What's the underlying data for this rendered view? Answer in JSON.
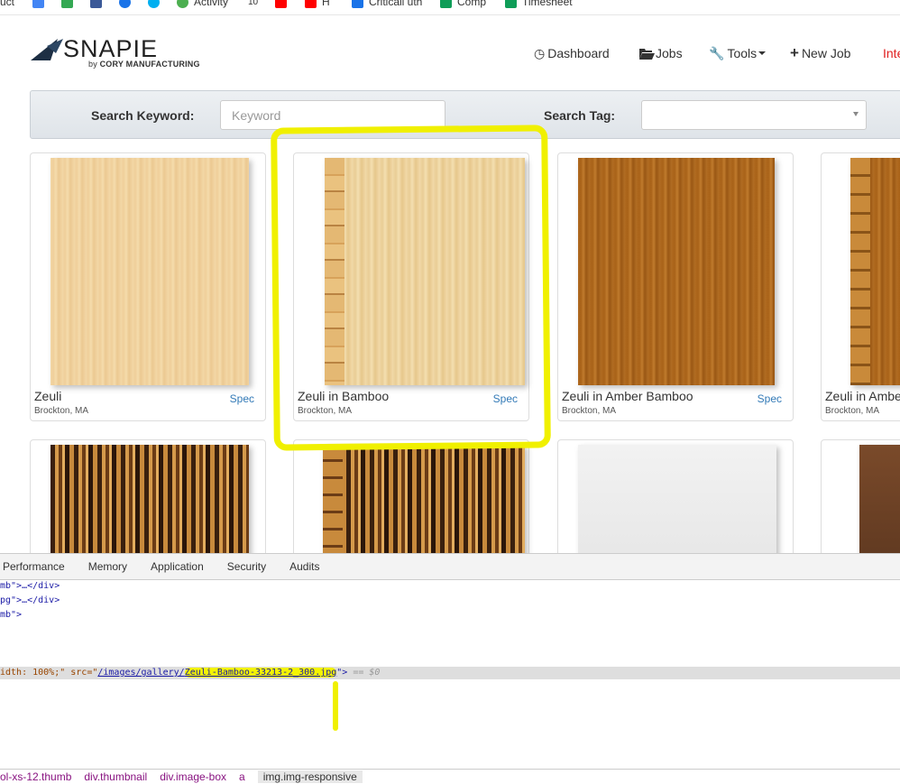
{
  "bookmarks": [
    {
      "label": "uct",
      "color": "#ffffff"
    },
    {
      "label": "",
      "color": "#4285f4"
    },
    {
      "label": "",
      "color": "#34a853"
    },
    {
      "label": "",
      "color": "#3b5998"
    },
    {
      "label": "",
      "color": "#1a73e8"
    },
    {
      "label": "",
      "color": "#00aff0"
    },
    {
      "label": "Activity",
      "color": "#4caf50"
    },
    {
      "label": "10",
      "color": "#ffffff"
    },
    {
      "label": "",
      "color": "#ff0000"
    },
    {
      "label": "H",
      "color": "#ff0000"
    },
    {
      "label": "Criticall uth",
      "color": "#1a73e8"
    },
    {
      "label": "Comp",
      "color": "#0f9d58"
    },
    {
      "label": "Timesheet",
      "color": "#0f9d58"
    }
  ],
  "logo": {
    "word": "SNAPIE",
    "by": "by",
    "company": "CORY MANUFACTURING"
  },
  "nav": {
    "dashboard": "Dashboard",
    "jobs": "Jobs",
    "tools": "Tools",
    "new_job": "New Job",
    "cut": "Inte"
  },
  "search": {
    "keyword_label": "Search Keyword:",
    "keyword_placeholder": "Keyword",
    "tag_label": "Search Tag:",
    "tag_value": ""
  },
  "cards": [
    {
      "title": "Zeuli",
      "spec": "Spec",
      "location": "Brockton, MA"
    },
    {
      "title": "Zeuli in Bamboo",
      "spec": "Spec",
      "location": "Brockton, MA"
    },
    {
      "title": "Zeuli in Amber Bamboo",
      "spec": "Spec",
      "location": "Brockton, MA"
    },
    {
      "title": "Zeuli in Ambe",
      "spec": "",
      "location": "Brockton, MA"
    }
  ],
  "devtools": {
    "tabs": [
      "Performance",
      "Memory",
      "Application",
      "Security",
      "Audits"
    ],
    "lines": [
      "mb\">…</div>",
      "pg\">…</div>",
      "mb\">"
    ],
    "selected": {
      "attr_prefix": "idth: 100%;\" src=\"",
      "src_dir": "/images/gallery/",
      "src_file": "Zeuli-Bamboo-33213-2_300.jpg",
      "after": "\">",
      "eq": " == $0"
    },
    "breadcrumb": [
      "ol-xs-12.thumb",
      "div.thumbnail",
      "div.image-box",
      "a",
      "img.img-responsive"
    ]
  },
  "colors": {
    "highlight": "#f0f000",
    "link": "#337ab7",
    "nav_red": "#e02020"
  }
}
